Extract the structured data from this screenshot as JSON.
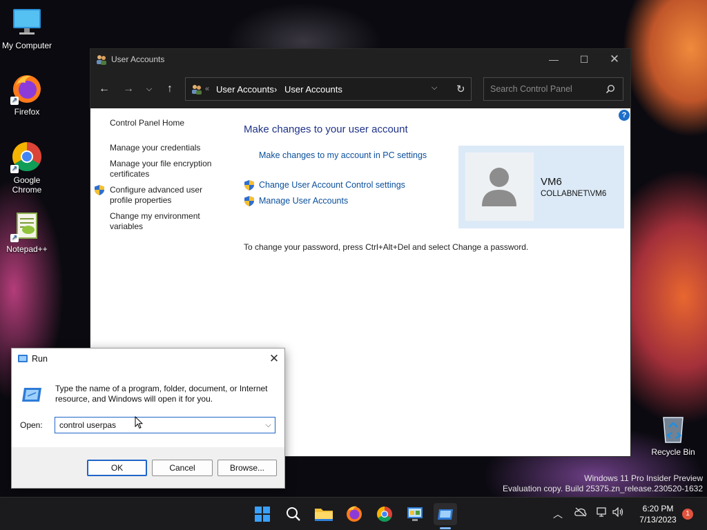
{
  "desktop": {
    "icons": [
      {
        "label": "My Computer",
        "icon": "monitor-icon"
      },
      {
        "label": "Firefox",
        "icon": "firefox-icon"
      },
      {
        "label": "Google Chrome",
        "icon": "chrome-icon"
      },
      {
        "label": "Notepad++",
        "icon": "notepadpp-icon"
      },
      {
        "label": "Recycle Bin",
        "icon": "recycle-bin-icon"
      }
    ]
  },
  "control_panel": {
    "title": "User Accounts",
    "breadcrumb": [
      "User Accounts",
      "User Accounts"
    ],
    "search_placeholder": "Search Control Panel",
    "sidebar": [
      "Control Panel Home",
      "Manage your credentials",
      "Manage your file encryption certificates",
      "Configure advanced user profile properties",
      "Change my environment variables"
    ],
    "heading": "Make changes to your user account",
    "links": {
      "pc_settings": "Make changes to my account in PC settings",
      "uac": "Change User Account Control settings",
      "manage": "Manage User Accounts"
    },
    "password_note": "To change your password, press Ctrl+Alt+Del and select Change a password.",
    "user": {
      "name": "VM6",
      "domain": "COLLABNET\\VM6"
    },
    "help_glyph": "?"
  },
  "run_dialog": {
    "title": "Run",
    "description": "Type the name of a program, folder, document, or Internet resource, and Windows will open it for you.",
    "open_label": "Open:",
    "open_value": "control userpas",
    "ok": "OK",
    "cancel": "Cancel",
    "browse": "Browse..."
  },
  "watermark": {
    "line1": "Windows 11 Pro Insider Preview",
    "line2": "Evaluation copy. Build 25375.zn_release.230520-1632"
  },
  "taskbar": {
    "time": "6:20 PM",
    "date": "7/13/2023",
    "notification_count": "1"
  },
  "colors": {
    "link": "#0a4f9c",
    "heading": "#1e3287",
    "accent": "#1e64c8",
    "user_card": "#dceaf7"
  }
}
